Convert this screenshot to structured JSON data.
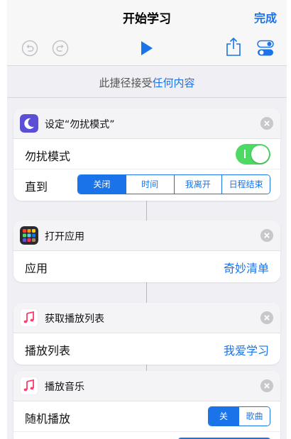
{
  "nav": {
    "title": "开始学习",
    "done_label": "完成"
  },
  "subtitle": {
    "prefix": "此捷径接受",
    "link": "任何内容"
  },
  "actions": [
    {
      "title": "设定“勿扰模式”",
      "icon": "moon-icon",
      "rows": [
        {
          "label": "勿扰模式",
          "toggle_on": true
        },
        {
          "label": "直到",
          "segments": [
            "关闭",
            "时间",
            "我离开",
            "日程结束"
          ],
          "selected": "关闭"
        }
      ]
    },
    {
      "title": "打开应用",
      "icon": "app-grid-icon",
      "rows": [
        {
          "label": "应用",
          "value": "奇妙清单"
        }
      ]
    },
    {
      "title": "获取播放列表",
      "icon": "music-note-icon",
      "rows": [
        {
          "label": "播放列表",
          "value": "我爱学习"
        }
      ]
    },
    {
      "title": "播放音乐",
      "icon": "music-note-icon",
      "rows": [
        {
          "label": "随机播放",
          "segments": [
            "关",
            "歌曲"
          ],
          "selected": "关"
        }
      ]
    }
  ],
  "colors": {
    "accent": "#1a73e8",
    "toggle_on": "#4cd964",
    "dnd_icon": "#5b4fd6"
  }
}
